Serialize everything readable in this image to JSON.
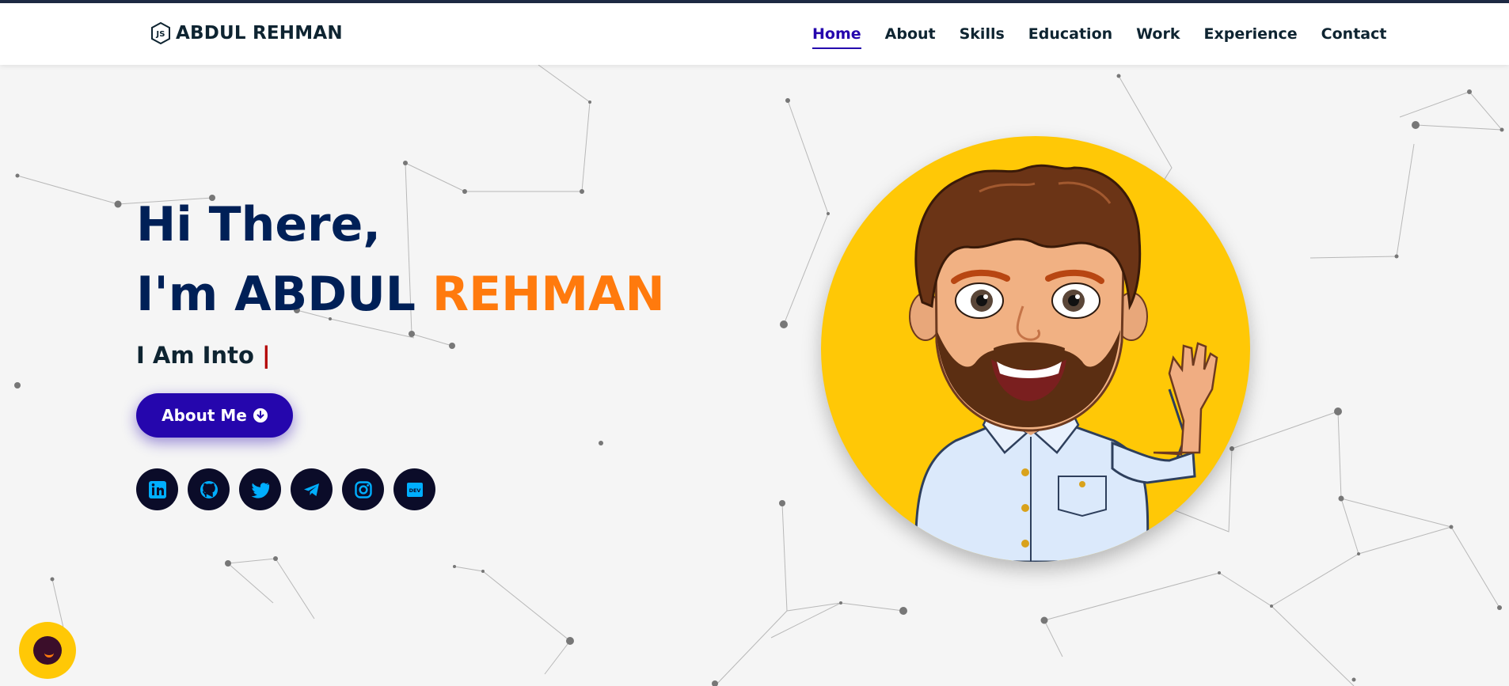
{
  "brand": {
    "name": "ABDUL REHMAN",
    "logo_icon": "js-hexagon-icon"
  },
  "nav": {
    "items": [
      {
        "label": "Home",
        "active": true
      },
      {
        "label": "About",
        "active": false
      },
      {
        "label": "Skills",
        "active": false
      },
      {
        "label": "Education",
        "active": false
      },
      {
        "label": "Work",
        "active": false
      },
      {
        "label": "Experience",
        "active": false
      },
      {
        "label": "Contact",
        "active": false
      }
    ]
  },
  "hero": {
    "greeting": "Hi There,",
    "intro_prefix": "I'm ABDUL",
    "intro_accent": "REHMAN",
    "into_label": "I Am Into",
    "caret": "|",
    "about_button": "About Me",
    "about_button_icon": "arrow-down-circle-icon"
  },
  "socials": [
    {
      "name": "linkedin-icon"
    },
    {
      "name": "github-icon"
    },
    {
      "name": "twitter-icon"
    },
    {
      "name": "telegram-icon"
    },
    {
      "name": "instagram-icon"
    },
    {
      "name": "dev-icon",
      "label": "DEV"
    }
  ],
  "colors": {
    "primary": "#2506ad",
    "heading": "#002057",
    "accent": "#ff7a0d",
    "avatar_bg": "#ffc806",
    "social_bg": "#0b0c29",
    "social_icon": "#00aeff"
  },
  "chat": {
    "icon": "chat-bubble-icon"
  }
}
